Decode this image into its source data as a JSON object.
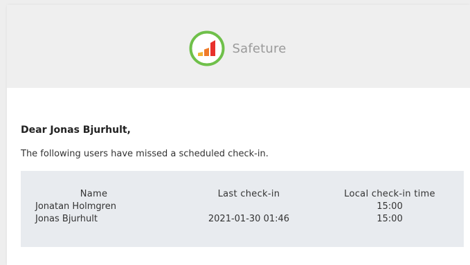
{
  "brand": {
    "name": "Safeture",
    "logo_icon": "bar-chart-logo-icon",
    "colors": {
      "ring": "#6fc04a",
      "bar1": "#f2b233",
      "bar2": "#ef7b2a",
      "bar3": "#e8312c",
      "header_bg": "#efefef",
      "table_bg": "#e8ebef"
    }
  },
  "message": {
    "greeting": "Dear Jonas Bjurhult,",
    "intro": "The following users have missed a scheduled check-in."
  },
  "table": {
    "headers": {
      "name": "Name",
      "last": "Last check-in",
      "local": "Local check-in time"
    },
    "rows": [
      {
        "name": "Jonatan Holmgren",
        "last": "",
        "local": "15:00"
      },
      {
        "name": "Jonas Bjurhult",
        "last": "2021-01-30 01:46",
        "local": "15:00"
      }
    ]
  }
}
